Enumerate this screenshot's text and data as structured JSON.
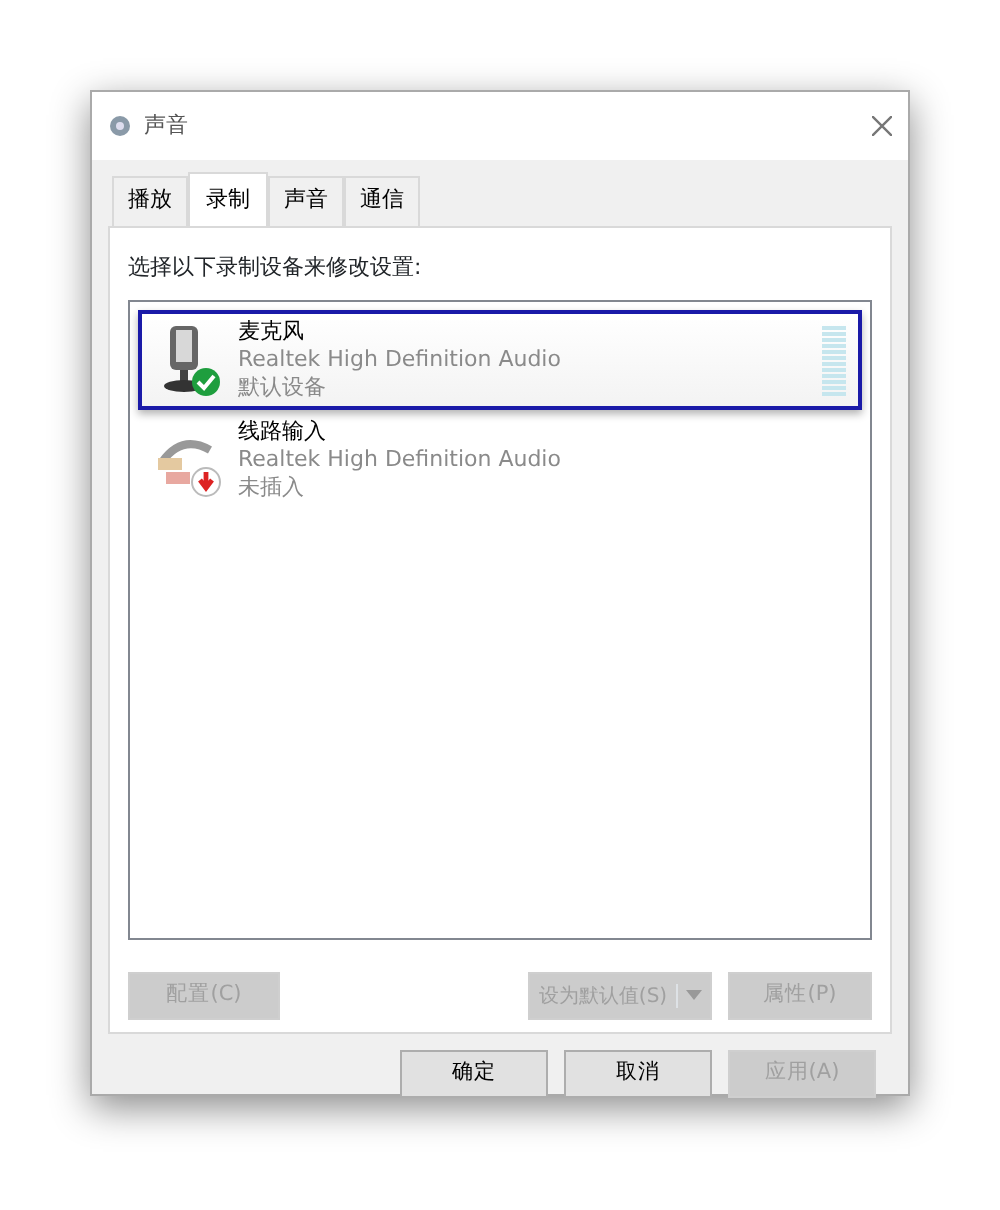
{
  "window": {
    "title": "声音"
  },
  "tabs": [
    {
      "label": "播放",
      "selected": false
    },
    {
      "label": "录制",
      "selected": true
    },
    {
      "label": "声音",
      "selected": false
    },
    {
      "label": "通信",
      "selected": false
    }
  ],
  "instruction": "选择以下录制设备来修改设置:",
  "devices": [
    {
      "kind": "microphone",
      "name": "麦克风",
      "driver": "Realtek High Definition Audio",
      "status": {
        "text": "默认设备",
        "kind": "default"
      },
      "selected": true
    },
    {
      "kind": "line-in",
      "name": "线路输入",
      "driver": "Realtek High Definition Audio",
      "status": {
        "text": "未插入",
        "kind": "unplugged"
      },
      "selected": false
    }
  ],
  "panel_buttons": [
    {
      "label": "配置(C)",
      "disabled": true
    },
    {
      "label": "设为默认值(S)",
      "disabled": true,
      "split": true
    },
    {
      "label": "属性(P)",
      "disabled": true
    }
  ],
  "dialog_buttons": [
    {
      "label": "确定",
      "disabled": false
    },
    {
      "label": "取消",
      "disabled": false
    },
    {
      "label": "应用(A)",
      "disabled": true
    }
  ]
}
